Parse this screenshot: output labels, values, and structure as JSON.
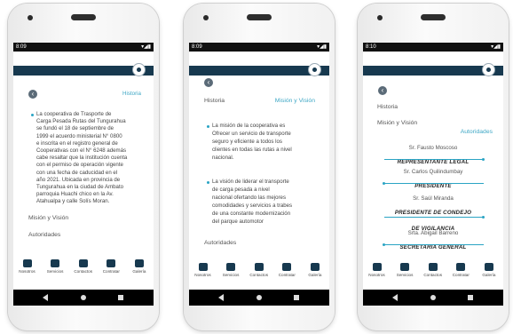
{
  "status": {
    "time1": "8:09",
    "time2": "8:09",
    "time3": "8:10",
    "icons": "▾◢▮"
  },
  "screen1": {
    "historia_link": "Historia",
    "paragraph_lines": [
      "La cooperativa de Trasporte de",
      "Carga Pesada Rutas del Tungurahua",
      "se fundó el 18 de septiembre de",
      "1999 el acuerdo ministerial N° 0800",
      "e inscrita en el registro general de",
      "Cooperativas con el N° 6248 además",
      "cabe resaltar que la institución cuenta",
      "con el permiso de operación vigente",
      "con una fecha de caducidad en el",
      "año 2021. Ubicada en provincia de",
      "Tungurahua en la ciudad de Ambato",
      "parroquia Huachi chico en la Av.",
      "Atahualpa y calle Solís Moran."
    ],
    "mision_vision": "Misión y Visión",
    "autoridades": "Autoridades"
  },
  "screen2": {
    "historia": "Historia",
    "mision_link": "Misión y Visión",
    "mision_lines": [
      "La misión de la cooperativa es",
      "Ofrecer un servicio de transporte",
      "seguro y eficiente a todos los",
      "clientes en todas las rutas a nivel",
      "nacional."
    ],
    "vision_lines": [
      "La visión de liderar el transporte",
      "de carga pesada a nivel",
      "nacional ofertando las mejores",
      "comodidades y servicios a trabes",
      "de una constante modernización",
      "del parque automotor"
    ],
    "autoridades": "Autoridades"
  },
  "screen3": {
    "historia": "Historia",
    "mision_vision": "Misión y Visión",
    "autoridades_link": "Autoridades",
    "authorities": [
      {
        "name": "Sr. Fausto Moscoso",
        "role_lines": [
          "REPRESENTANTE LEGAL"
        ]
      },
      {
        "name": "Sr. Carlos Quilindumbay",
        "role_lines": [
          "PRESIDENTE"
        ]
      },
      {
        "name": "Sr. Saúl Miranda",
        "role_lines": [
          "PRESIDENTE DE CONDEJO",
          "DE VIGILANCIA"
        ]
      },
      {
        "name": "Srta. Abigail Barreno",
        "role_lines": [
          "SECRETARIA GENERAL"
        ]
      }
    ]
  },
  "tabs": [
    "Nosotros",
    "Servicios",
    "Contactos",
    "Contratar",
    "Galería"
  ],
  "tab_icons": [
    "bus-icon",
    "user-icon",
    "phone-icon",
    "building-icon",
    "camera-icon"
  ],
  "colors": {
    "appbar": "#17394f",
    "accent": "#3ea7c5",
    "bullet": "#2aa4c4"
  }
}
